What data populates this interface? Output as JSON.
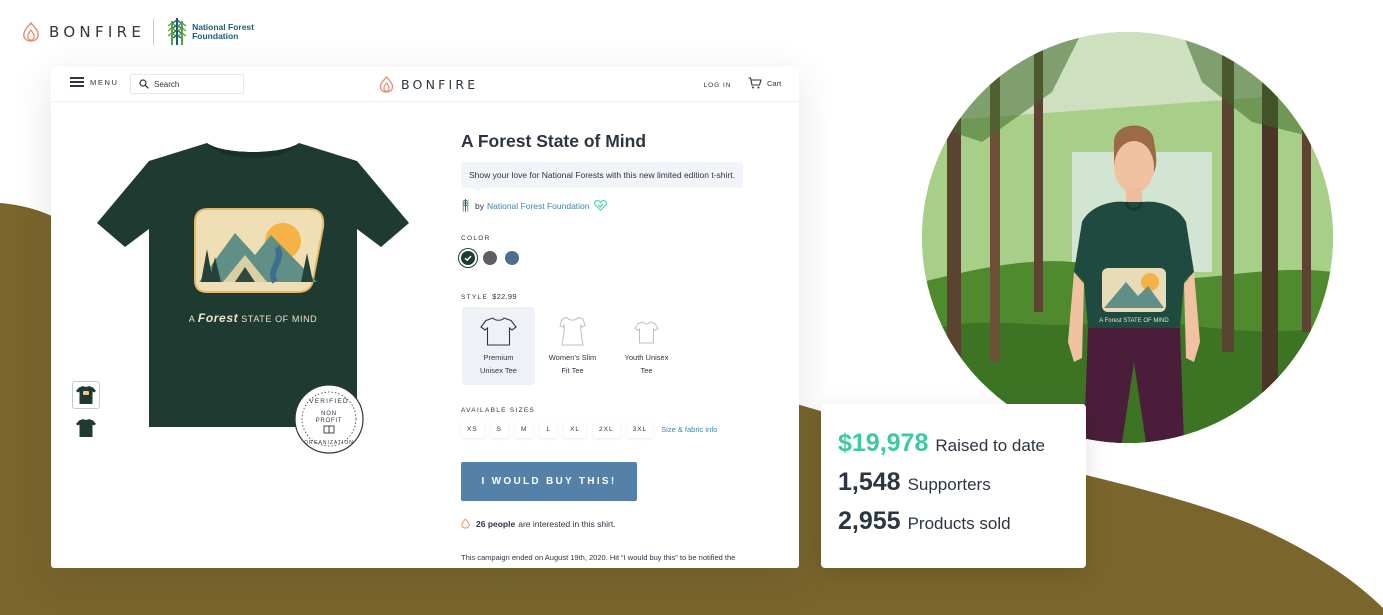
{
  "brand": {
    "name": "BONFIRE",
    "partner": "National Forest Foundation",
    "partner_line1": "National Forest",
    "partner_line2": "Foundation"
  },
  "nav": {
    "menu_label": "MENU",
    "search_placeholder": "Search",
    "logo_text": "BONFIRE",
    "login_label": "LOG IN",
    "cart_label": "Cart"
  },
  "product": {
    "title": "A Forest State of Mind",
    "description": "Show your love for National Forests with this new limited edition t-shirt.",
    "by_label": "by",
    "organization": "National Forest Foundation",
    "shirt_text": "A Forest STATE OF MIND",
    "badge_text": [
      "VERIFIED",
      "NON",
      "PROFIT",
      "ORGANIZATION"
    ],
    "color_label": "COLOR",
    "colors": [
      "#1f3a31",
      "#5c5f63",
      "#4d6c8e"
    ],
    "selected_color": 0,
    "style_label": "STYLE",
    "style_price": "$22.99",
    "styles": [
      {
        "line1": "Premium",
        "line2": "Unisex Tee",
        "selected": true
      },
      {
        "line1": "Women's Slim",
        "line2": "Fit Tee",
        "selected": false
      },
      {
        "line1": "Youth Unisex",
        "line2": "Tee",
        "selected": false
      }
    ],
    "sizes_label": "AVAILABLE SIZES",
    "sizes": [
      "XS",
      "S",
      "M",
      "L",
      "XL",
      "2XL",
      "3XL"
    ],
    "size_info": "Size & fabric info",
    "buy_label": "I WOULD BUY THIS!",
    "interest_count": "26 people",
    "interest_text": "are interested in this shirt.",
    "ended_text": "This campaign ended on August 19th, 2020. Hit “I would buy this” to be notified the"
  },
  "stats": [
    {
      "value": "$19,978",
      "label": "Raised to date"
    },
    {
      "value": "1,548",
      "label": "Supporters"
    },
    {
      "value": "2,955",
      "label": "Products sold"
    }
  ],
  "colors": {
    "accent_blue": "#5580a8",
    "stat_green": "#3ec9a0",
    "wave_olive": "#7a652c",
    "shirt_green": "#1f3a31"
  }
}
